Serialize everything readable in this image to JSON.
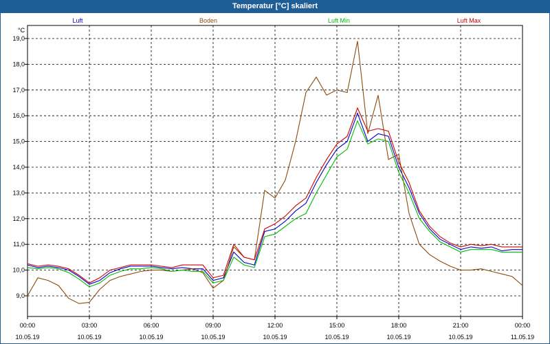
{
  "window": {
    "title": "Temperatur [°C] skaliert"
  },
  "chart_data": {
    "type": "line",
    "title": "Temperatur [°C] skaliert",
    "ylabel": "°C",
    "ylim": [
      8.5,
      19.3
    ],
    "xlim": [
      "2019-05-10 00:00",
      "2019-05-11 00:00"
    ],
    "grid": true,
    "legend_position": "top",
    "y_ticks": [
      "9,0",
      "10,0",
      "11,0",
      "12,0",
      "13,0",
      "14,0",
      "15,0",
      "16,0",
      "17,0",
      "18,0",
      "19,0"
    ],
    "x_ticks": [
      {
        "time": "00:00",
        "date": "10.05.19"
      },
      {
        "time": "03:00",
        "date": "10.05.19"
      },
      {
        "time": "06:00",
        "date": "10.05.19"
      },
      {
        "time": "09:00",
        "date": "10.05.19"
      },
      {
        "time": "12:00",
        "date": "10.05.19"
      },
      {
        "time": "15:00",
        "date": "10.05.19"
      },
      {
        "time": "18:00",
        "date": "10.05.19"
      },
      {
        "time": "21:00",
        "date": "10.05.19"
      },
      {
        "time": "00:00",
        "date": "11.05.19"
      }
    ],
    "series": [
      {
        "name": "Luft",
        "color": "#0000cc",
        "x_hours": [
          0,
          0.5,
          1,
          1.5,
          2,
          2.5,
          3,
          3.5,
          4,
          4.5,
          5,
          5.5,
          6,
          6.5,
          7,
          7.5,
          8,
          8.5,
          9,
          9.5,
          10,
          10.5,
          11,
          11.5,
          12,
          12.5,
          13,
          13.5,
          14,
          14.5,
          15,
          15.5,
          16,
          16.5,
          17,
          17.5,
          18,
          18.5,
          19,
          19.5,
          20,
          20.5,
          21,
          21.5,
          22,
          22.5,
          23,
          23.5,
          24
        ],
        "values": [
          10.2,
          10.1,
          10.15,
          10.1,
          10.0,
          9.75,
          9.45,
          9.6,
          9.9,
          10.05,
          10.15,
          10.15,
          10.15,
          10.1,
          10.05,
          10.1,
          10.05,
          10.05,
          9.6,
          9.7,
          10.7,
          10.3,
          10.2,
          11.5,
          11.6,
          11.9,
          12.3,
          12.6,
          13.4,
          14.1,
          14.7,
          15.0,
          16.1,
          15.0,
          15.3,
          15.2,
          14.0,
          13.2,
          12.2,
          11.6,
          11.2,
          11.0,
          10.8,
          10.9,
          10.85,
          10.9,
          10.75,
          10.8,
          10.8
        ]
      },
      {
        "name": "Boden",
        "color": "#8b4a0a",
        "x_hours": [
          0,
          0.5,
          1,
          1.5,
          2,
          2.5,
          3,
          3.5,
          4,
          4.5,
          5,
          5.5,
          6,
          6.5,
          7,
          7.5,
          8,
          8.5,
          9,
          9.5,
          10,
          10.5,
          11,
          11.5,
          12,
          12.5,
          13,
          13.5,
          14,
          14.5,
          15,
          15.5,
          16,
          16.5,
          17,
          17.5,
          18,
          18.5,
          19,
          19.5,
          20,
          20.5,
          21,
          21.5,
          22,
          22.5,
          23,
          23.5,
          24
        ],
        "values": [
          9.0,
          9.7,
          9.6,
          9.4,
          8.9,
          8.7,
          8.75,
          9.25,
          9.6,
          9.75,
          9.85,
          9.95,
          10.0,
          10.0,
          9.95,
          10.0,
          10.05,
          9.9,
          9.3,
          9.6,
          10.9,
          10.5,
          10.4,
          13.1,
          12.8,
          13.5,
          15.0,
          16.9,
          17.5,
          16.8,
          17.0,
          16.9,
          18.9,
          15.3,
          16.8,
          14.3,
          14.5,
          12.2,
          11.0,
          10.6,
          10.35,
          10.15,
          10.0,
          10.0,
          10.05,
          9.95,
          9.85,
          9.75,
          9.4
        ]
      },
      {
        "name": "Luft Min",
        "color": "#00bb00",
        "x_hours": [
          0,
          0.5,
          1,
          1.5,
          2,
          2.5,
          3,
          3.5,
          4,
          4.5,
          5,
          5.5,
          6,
          6.5,
          7,
          7.5,
          8,
          8.5,
          9,
          9.5,
          10,
          10.5,
          11,
          11.5,
          12,
          12.5,
          13,
          13.5,
          14,
          14.5,
          15,
          15.5,
          16,
          16.5,
          17,
          17.5,
          18,
          18.5,
          19,
          19.5,
          20,
          20.5,
          21,
          21.5,
          22,
          22.5,
          23,
          23.5,
          24
        ],
        "values": [
          10.1,
          10.05,
          10.1,
          10.05,
          9.9,
          9.65,
          9.35,
          9.5,
          9.8,
          9.95,
          10.05,
          10.05,
          10.1,
          10.05,
          9.95,
          10.0,
          9.95,
          9.95,
          9.5,
          9.6,
          10.5,
          10.2,
          10.1,
          11.3,
          11.4,
          11.7,
          12.0,
          12.2,
          13.0,
          13.7,
          14.4,
          14.7,
          15.8,
          14.9,
          15.1,
          15.0,
          13.8,
          13.0,
          12.0,
          11.5,
          11.1,
          10.9,
          10.7,
          10.8,
          10.8,
          10.8,
          10.7,
          10.7,
          10.7
        ]
      },
      {
        "name": "Luft Max",
        "color": "#cc0000",
        "x_hours": [
          0,
          0.5,
          1,
          1.5,
          2,
          2.5,
          3,
          3.5,
          4,
          4.5,
          5,
          5.5,
          6,
          6.5,
          7,
          7.5,
          8,
          8.5,
          9,
          9.5,
          10,
          10.5,
          11,
          11.5,
          12,
          12.5,
          13,
          13.5,
          14,
          14.5,
          15,
          15.5,
          16,
          16.5,
          17,
          17.5,
          18,
          18.5,
          19,
          19.5,
          20,
          20.5,
          21,
          21.5,
          22,
          22.5,
          23,
          23.5,
          24
        ],
        "values": [
          10.25,
          10.15,
          10.2,
          10.15,
          10.05,
          9.8,
          9.5,
          9.7,
          10.0,
          10.1,
          10.2,
          10.2,
          10.2,
          10.15,
          10.1,
          10.2,
          10.2,
          10.2,
          9.7,
          9.8,
          11.0,
          10.5,
          10.4,
          11.6,
          11.8,
          12.1,
          12.5,
          12.8,
          13.6,
          14.3,
          14.9,
          15.2,
          16.3,
          15.4,
          15.5,
          15.4,
          14.2,
          13.4,
          12.3,
          11.7,
          11.3,
          11.05,
          10.9,
          11.0,
          10.95,
          11.0,
          10.9,
          10.9,
          10.9
        ]
      }
    ]
  }
}
